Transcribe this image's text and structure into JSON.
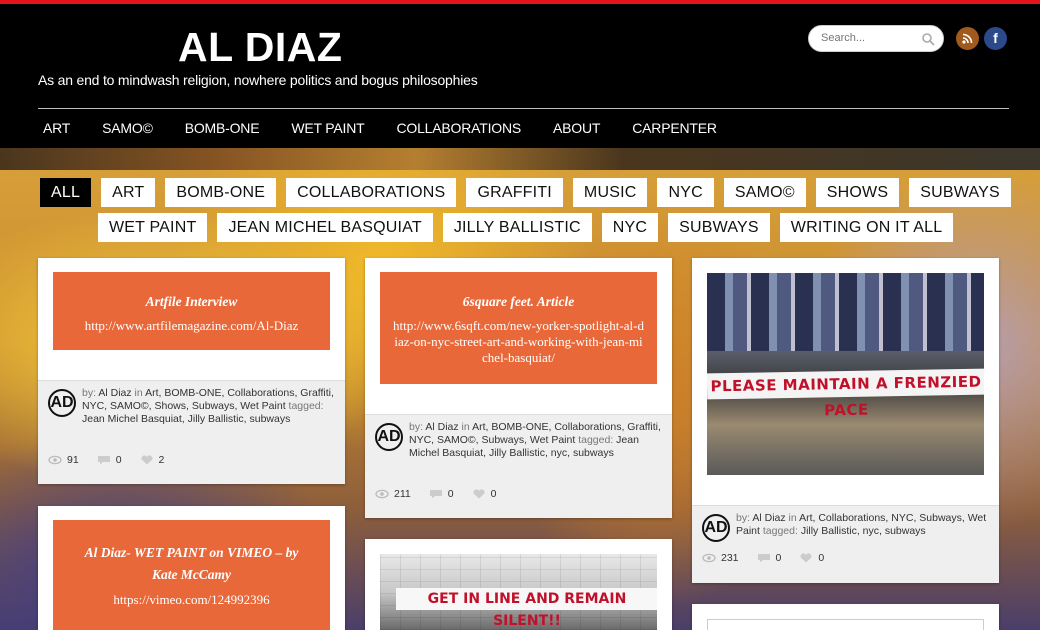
{
  "site": {
    "title": "AL DIAZ",
    "tagline": "As an end to mindwash religion, nowhere politics and bogus philosophies",
    "search_placeholder": "Search..."
  },
  "nav": [
    "ART",
    "SAMO©",
    "BOMB-ONE",
    "WET PAINT",
    "COLLABORATIONS",
    "ABOUT",
    "CARPENTER"
  ],
  "filters_row1": [
    "ALL",
    "ART",
    "BOMB-ONE",
    "COLLABORATIONS",
    "GRAFFITI",
    "MUSIC",
    "NYC",
    "SAMO©",
    "SHOWS",
    "SUBWAYS"
  ],
  "filters_row2": [
    "WET PAINT",
    "JEAN MICHEL BASQUIAT",
    "JILLY BALLISTIC",
    "NYC",
    "SUBWAYS",
    "WRITING ON IT ALL"
  ],
  "cards": [
    {
      "title": "Artfile Interview",
      "link": "http://www.artfilemagazine.com/Al-Diaz",
      "author": "Al Diaz",
      "categories": "Art, BOMB-ONE, Collaborations, Graffiti, NYC, SAMO©, Shows, Subways, Wet Paint",
      "tags": "Jean Michel Basquiat, Jilly Ballistic, subways",
      "views": "91",
      "comments": "0",
      "likes": "2"
    },
    {
      "title": "6square feet. Article",
      "link": "http://www.6sqft.com/new-yorker-spotlight-al-diaz-on-nyc-street-art-and-working-with-jean-michel-basquiat/",
      "author": "Al Diaz",
      "categories": "Art, BOMB-ONE, Collaborations, Graffiti, NYC, SAMO©, Subways, Wet Paint",
      "tags": "Jean Michel Basquiat, Jilly Ballistic, nyc, subways",
      "views": "211",
      "comments": "0",
      "likes": "0"
    },
    {
      "photo_text": "PLEASE MAINTAIN A FRENZIED PACE",
      "author": "Al Diaz",
      "categories": "Art, Collaborations, NYC, Subways, Wet Paint",
      "tags": "Jilly Ballistic, nyc, subways",
      "views": "231",
      "comments": "0",
      "likes": "0"
    },
    {
      "title": "Al Diaz- WET PAINT on VIMEO – by Kate McCamy",
      "link": "https://vimeo.com/124992396"
    },
    {
      "photo_text": "GET IN LINE AND REMAIN SILENT!!"
    }
  ],
  "labels": {
    "by": "by:",
    "in": "in",
    "tagged": "tagged:",
    "logo": "AD"
  },
  "colors": {
    "accent_orange": "#e8683a",
    "top_bar_red": "#e2141c"
  }
}
